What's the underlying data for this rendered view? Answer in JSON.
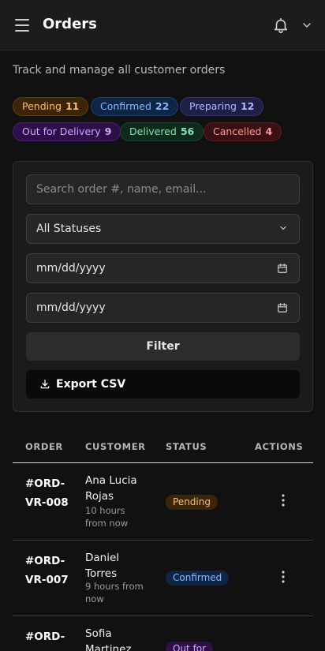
{
  "header": {
    "title": "Orders"
  },
  "subtitle": "Track and manage all customer orders",
  "status_chips": [
    {
      "label": "Pending",
      "count": "11"
    },
    {
      "label": "Confirmed",
      "count": "22"
    },
    {
      "label": "Preparing",
      "count": "12"
    },
    {
      "label": "Out for Delivery",
      "count": "9"
    },
    {
      "label": "Delivered",
      "count": "56"
    },
    {
      "label": "Cancelled",
      "count": "4"
    }
  ],
  "filters": {
    "search_placeholder": "Search order #, name, email...",
    "status_value": "All Statuses",
    "date_from": "mm/dd/yyyy",
    "date_to": "mm/dd/yyyy",
    "filter_label": "Filter",
    "export_label": "Export CSV"
  },
  "table": {
    "columns": [
      "ORDER",
      "CUSTOMER",
      "STATUS",
      "ACTIONS"
    ],
    "rows": [
      {
        "order": "#ORD-VR-008",
        "customer": "Ana Lucia Rojas",
        "time": "10 hours from now",
        "status": "Pending"
      },
      {
        "order": "#ORD-VR-007",
        "customer": "Daniel Torres",
        "time": "9 hours from now",
        "status": "Confirmed"
      },
      {
        "order": "#ORD-",
        "customer": "Sofia Martinez",
        "time": "",
        "status": "Out for"
      }
    ]
  },
  "colors": {
    "background": "#111111",
    "pending": "#fbbf6a",
    "confirmed": "#8ab8ff",
    "preparing": "#b4b4ff",
    "out_for_delivery": "#d3a6ff",
    "delivered": "#86e0b0",
    "cancelled": "#ff9a9a"
  },
  "icons": [
    "menu-icon",
    "bell-icon",
    "chevron-down-icon",
    "calendar-icon",
    "download-icon",
    "more-vertical-icon"
  ]
}
